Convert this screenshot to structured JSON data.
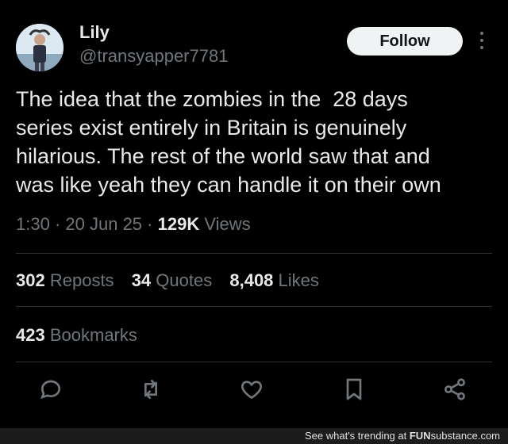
{
  "user": {
    "name": "Lily",
    "handle": "@transyapper7781"
  },
  "follow_label": "Follow",
  "tweet": {
    "lines": [
      "The idea that the zombies in the  28 days",
      "series exist entirely in Britain is genuinely",
      "hilarious. The rest of the world saw that and",
      "was like yeah they can handle it on their own"
    ]
  },
  "meta": {
    "time": "1:30",
    "sep": "·",
    "date": "20 Jun 25",
    "views_count": "129K",
    "views_label": "Views"
  },
  "stats": {
    "reposts_count": "302",
    "reposts_label": "Reposts",
    "quotes_count": "34",
    "quotes_label": "Quotes",
    "likes_count": "8,408",
    "likes_label": "Likes",
    "bookmarks_count": "423",
    "bookmarks_label": "Bookmarks"
  },
  "actions": [
    "reply-icon",
    "repost-icon",
    "like-icon",
    "bookmark-icon",
    "share-icon"
  ],
  "footer": {
    "text": "See what's trending at ",
    "brand_a": "FUN",
    "brand_b": "substance",
    "brand_c": ".com"
  },
  "colors": {
    "background": "#000000",
    "text": "#e7e9ea",
    "muted": "#71767b",
    "divider": "#2f3336",
    "follow_bg": "#eff3f4"
  }
}
